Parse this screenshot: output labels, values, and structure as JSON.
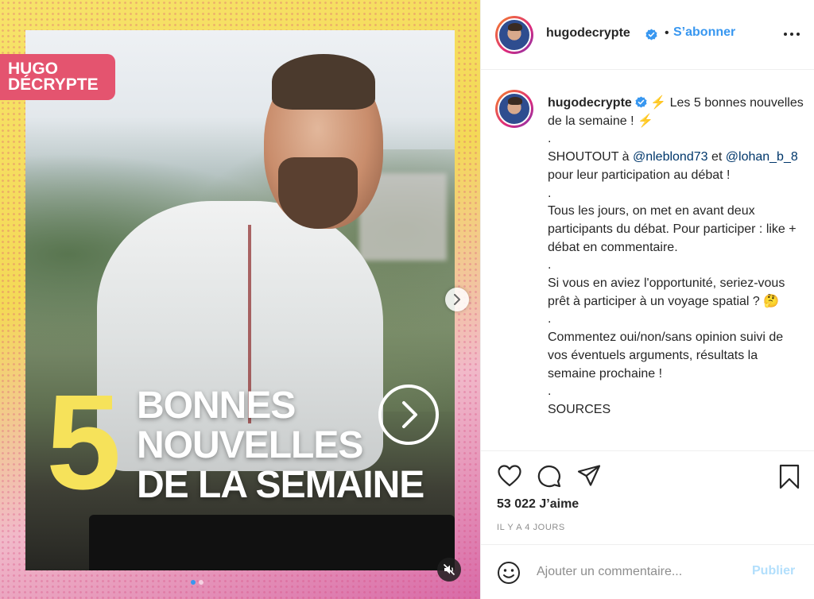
{
  "media": {
    "logo_line1": "HUGO",
    "logo_line2": "DÉCRYPTE",
    "number": "5",
    "title_lines": [
      "BONNES",
      "NOUVELLES",
      "DE LA SEMAINE"
    ],
    "icons": {
      "next": "chevron-right-icon",
      "mute": "speaker-muted-icon",
      "circle_arrow": "circle-arrow-right-icon"
    }
  },
  "header": {
    "username": "hugodecrypte",
    "separator": "•",
    "follow_label": "S’abonner",
    "more_icon": "more-horizontal-icon"
  },
  "caption": {
    "username": "hugodecrypte",
    "line1": " ⚡️ Les 5 bonnes nouvelles de la semaine ! ⚡️",
    "dot": ".",
    "shoutout_prefix": "SHOUTOUT à ",
    "mention1": "@nleblond73",
    "and_text": " et ",
    "mention2": "@lohan_b_8",
    "shoutout_suffix": " pour leur participation au débat !",
    "para2": "Tous les jours, on met en avant deux participants du débat. Pour participer : like + débat en commentaire.",
    "para3": "Si vous en aviez l'opportunité, seriez-vous prêt à participer à un voyage spatial ? 🤔",
    "para4": "Commentez oui/non/sans opinion suivi de vos éventuels arguments, résultats la semaine prochaine !",
    "para5": "SOURCES"
  },
  "actions": {
    "likes": "53 022 J’aime",
    "time_ago": "IL Y A 4 JOURS",
    "icons": [
      "heart-icon",
      "comment-icon",
      "share-icon",
      "bookmark-icon"
    ]
  },
  "comment": {
    "placeholder": "Ajouter un commentaire...",
    "publish_label": "Publier"
  },
  "colors": {
    "accent": "#3897f0",
    "publish_disabled": "#b2dffc",
    "logo_bg": "#e4546f",
    "five_yellow": "#f6e25a",
    "mention": "#00376b"
  }
}
